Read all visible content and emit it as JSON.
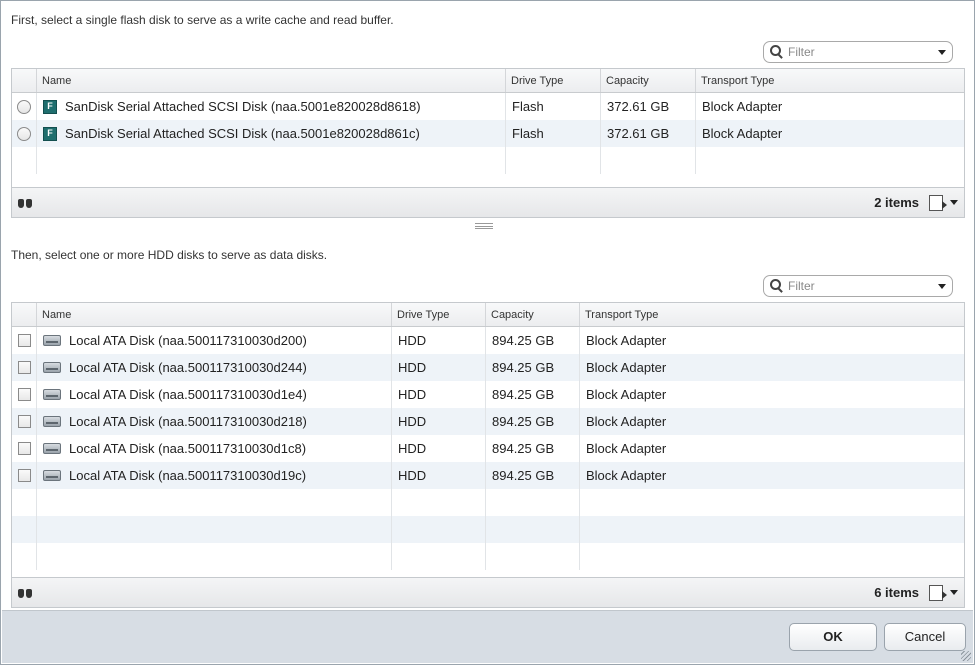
{
  "flash_section": {
    "instruction": "First, select a single flash disk to serve as a write cache and read buffer.",
    "filter_placeholder": "Filter",
    "columns": [
      "Name",
      "Drive Type",
      "Capacity",
      "Transport Type"
    ],
    "rows": [
      {
        "name": "SanDisk Serial Attached SCSI Disk (naa.5001e820028d8618)",
        "drive_type": "Flash",
        "capacity": "372.61 GB",
        "transport": "Block Adapter",
        "selected": false
      },
      {
        "name": "SanDisk Serial Attached SCSI Disk (naa.5001e820028d861c)",
        "drive_type": "Flash",
        "capacity": "372.61 GB",
        "transport": "Block Adapter",
        "selected": false
      }
    ],
    "item_count": "2 items",
    "icon_label": "F"
  },
  "hdd_section": {
    "instruction": "Then, select one or more HDD disks to serve as data disks.",
    "filter_placeholder": "Filter",
    "columns": [
      "Name",
      "Drive Type",
      "Capacity",
      "Transport Type"
    ],
    "rows": [
      {
        "name": "Local ATA Disk (naa.500117310030d200)",
        "drive_type": "HDD",
        "capacity": "894.25 GB",
        "transport": "Block Adapter",
        "checked": false
      },
      {
        "name": "Local ATA Disk (naa.500117310030d244)",
        "drive_type": "HDD",
        "capacity": "894.25 GB",
        "transport": "Block Adapter",
        "checked": false
      },
      {
        "name": "Local ATA Disk (naa.500117310030d1e4)",
        "drive_type": "HDD",
        "capacity": "894.25 GB",
        "transport": "Block Adapter",
        "checked": false
      },
      {
        "name": "Local ATA Disk (naa.500117310030d218)",
        "drive_type": "HDD",
        "capacity": "894.25 GB",
        "transport": "Block Adapter",
        "checked": false
      },
      {
        "name": "Local ATA Disk (naa.500117310030d1c8)",
        "drive_type": "HDD",
        "capacity": "894.25 GB",
        "transport": "Block Adapter",
        "checked": false
      },
      {
        "name": "Local ATA Disk (naa.500117310030d19c)",
        "drive_type": "HDD",
        "capacity": "894.25 GB",
        "transport": "Block Adapter",
        "checked": false
      }
    ],
    "item_count": "6 items"
  },
  "buttons": {
    "ok": "OK",
    "cancel": "Cancel"
  },
  "colors": {
    "flash_icon": "#1f6e6e",
    "row_alt": "#eef3f8",
    "footer_bar": "#d7dde4"
  },
  "icons": {
    "filter": "search-icon",
    "find": "binoculars-icon",
    "export": "export-icon",
    "flash": "flash-disk-icon",
    "hdd": "hdd-disk-icon"
  }
}
